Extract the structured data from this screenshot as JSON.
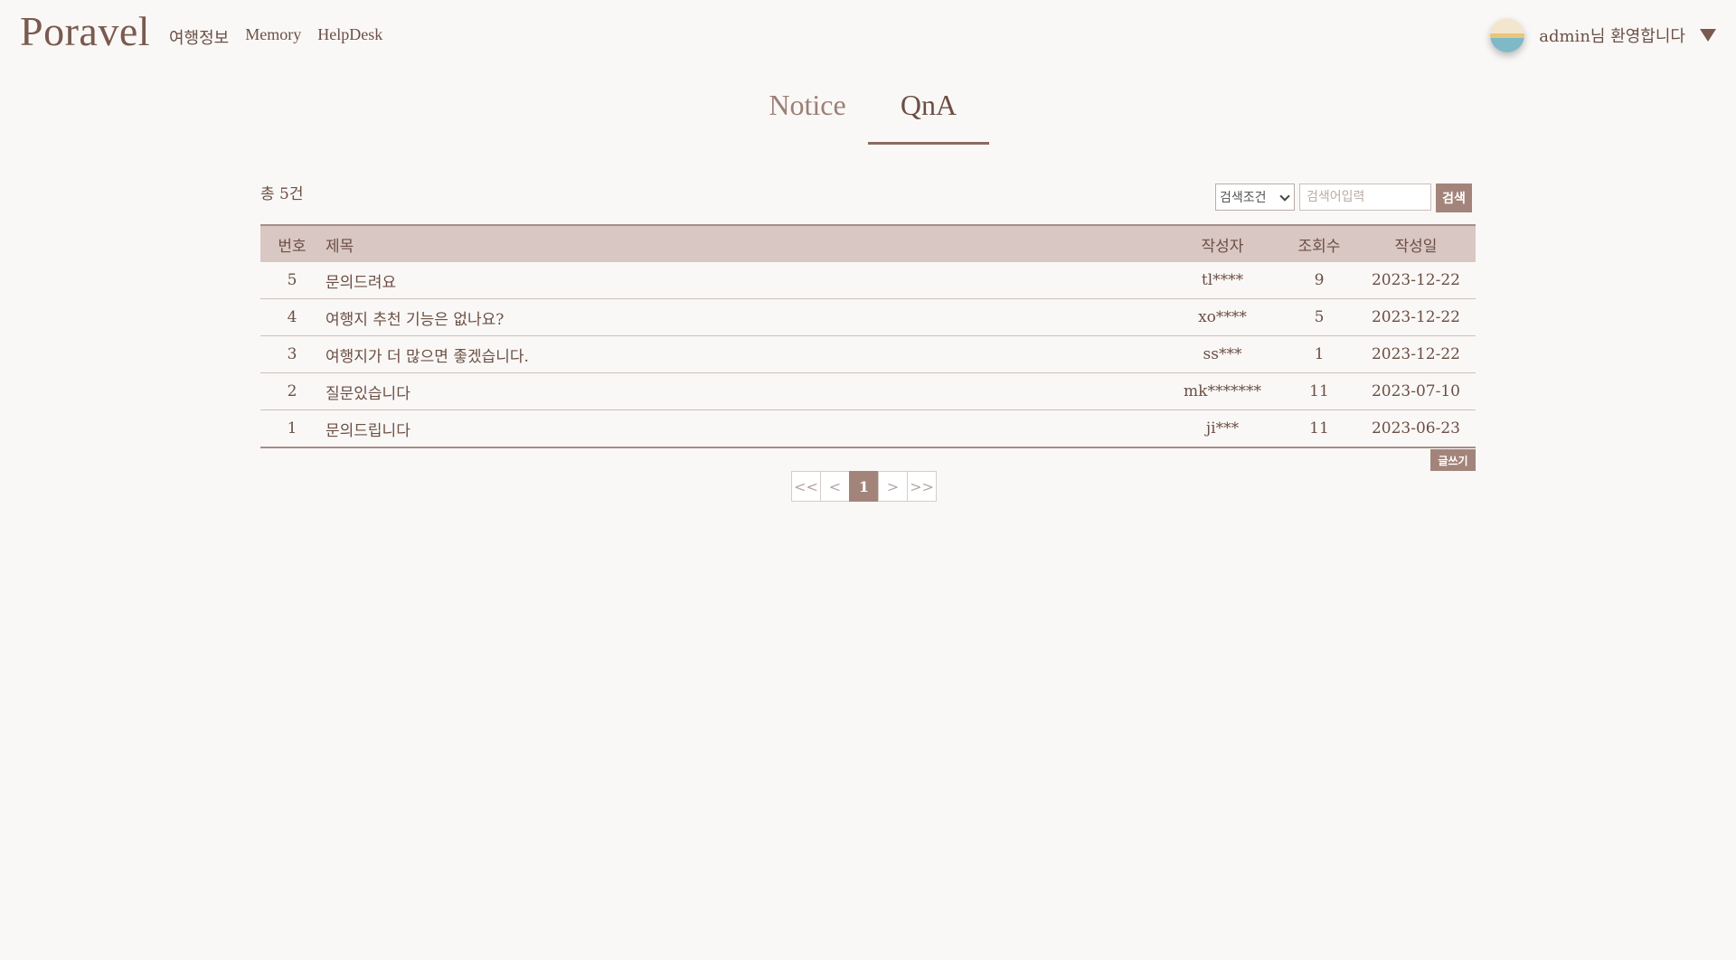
{
  "header": {
    "logo": "Poravel",
    "nav": [
      "여행정보",
      "Memory",
      "HelpDesk"
    ],
    "welcome": "admin님 환영합니다"
  },
  "tabs": [
    {
      "label": "Notice",
      "active": false
    },
    {
      "label": "QnA",
      "active": true
    }
  ],
  "board": {
    "total": "총 5건",
    "search": {
      "select_value": "검색조건",
      "placeholder": "검색어입력",
      "button": "검색"
    },
    "columns": [
      "번호",
      "제목",
      "작성자",
      "조회수",
      "작성일"
    ],
    "rows": [
      {
        "no": "5",
        "title": "문의드려요",
        "writer": "tl****",
        "views": "9",
        "date": "2023-12-22"
      },
      {
        "no": "4",
        "title": "여행지 추천 기능은 없나요?",
        "writer": "xo****",
        "views": "5",
        "date": "2023-12-22"
      },
      {
        "no": "3",
        "title": "여행지가 더 많으면 좋겠습니다.",
        "writer": "ss***",
        "views": "1",
        "date": "2023-12-22"
      },
      {
        "no": "2",
        "title": "질문있습니다",
        "writer": "mk*******",
        "views": "11",
        "date": "2023-07-10"
      },
      {
        "no": "1",
        "title": "문의드립니다",
        "writer": "ji***",
        "views": "11",
        "date": "2023-06-23"
      }
    ],
    "write_button": "글쓰기"
  },
  "pagination": {
    "first": "<<",
    "prev": "<",
    "current": "1",
    "next": ">",
    "last": ">>"
  },
  "colors": {
    "accent": "#a3847b",
    "text": "#6b4f45",
    "header_row": "#d9c7c3",
    "background": "#faf8f6"
  }
}
